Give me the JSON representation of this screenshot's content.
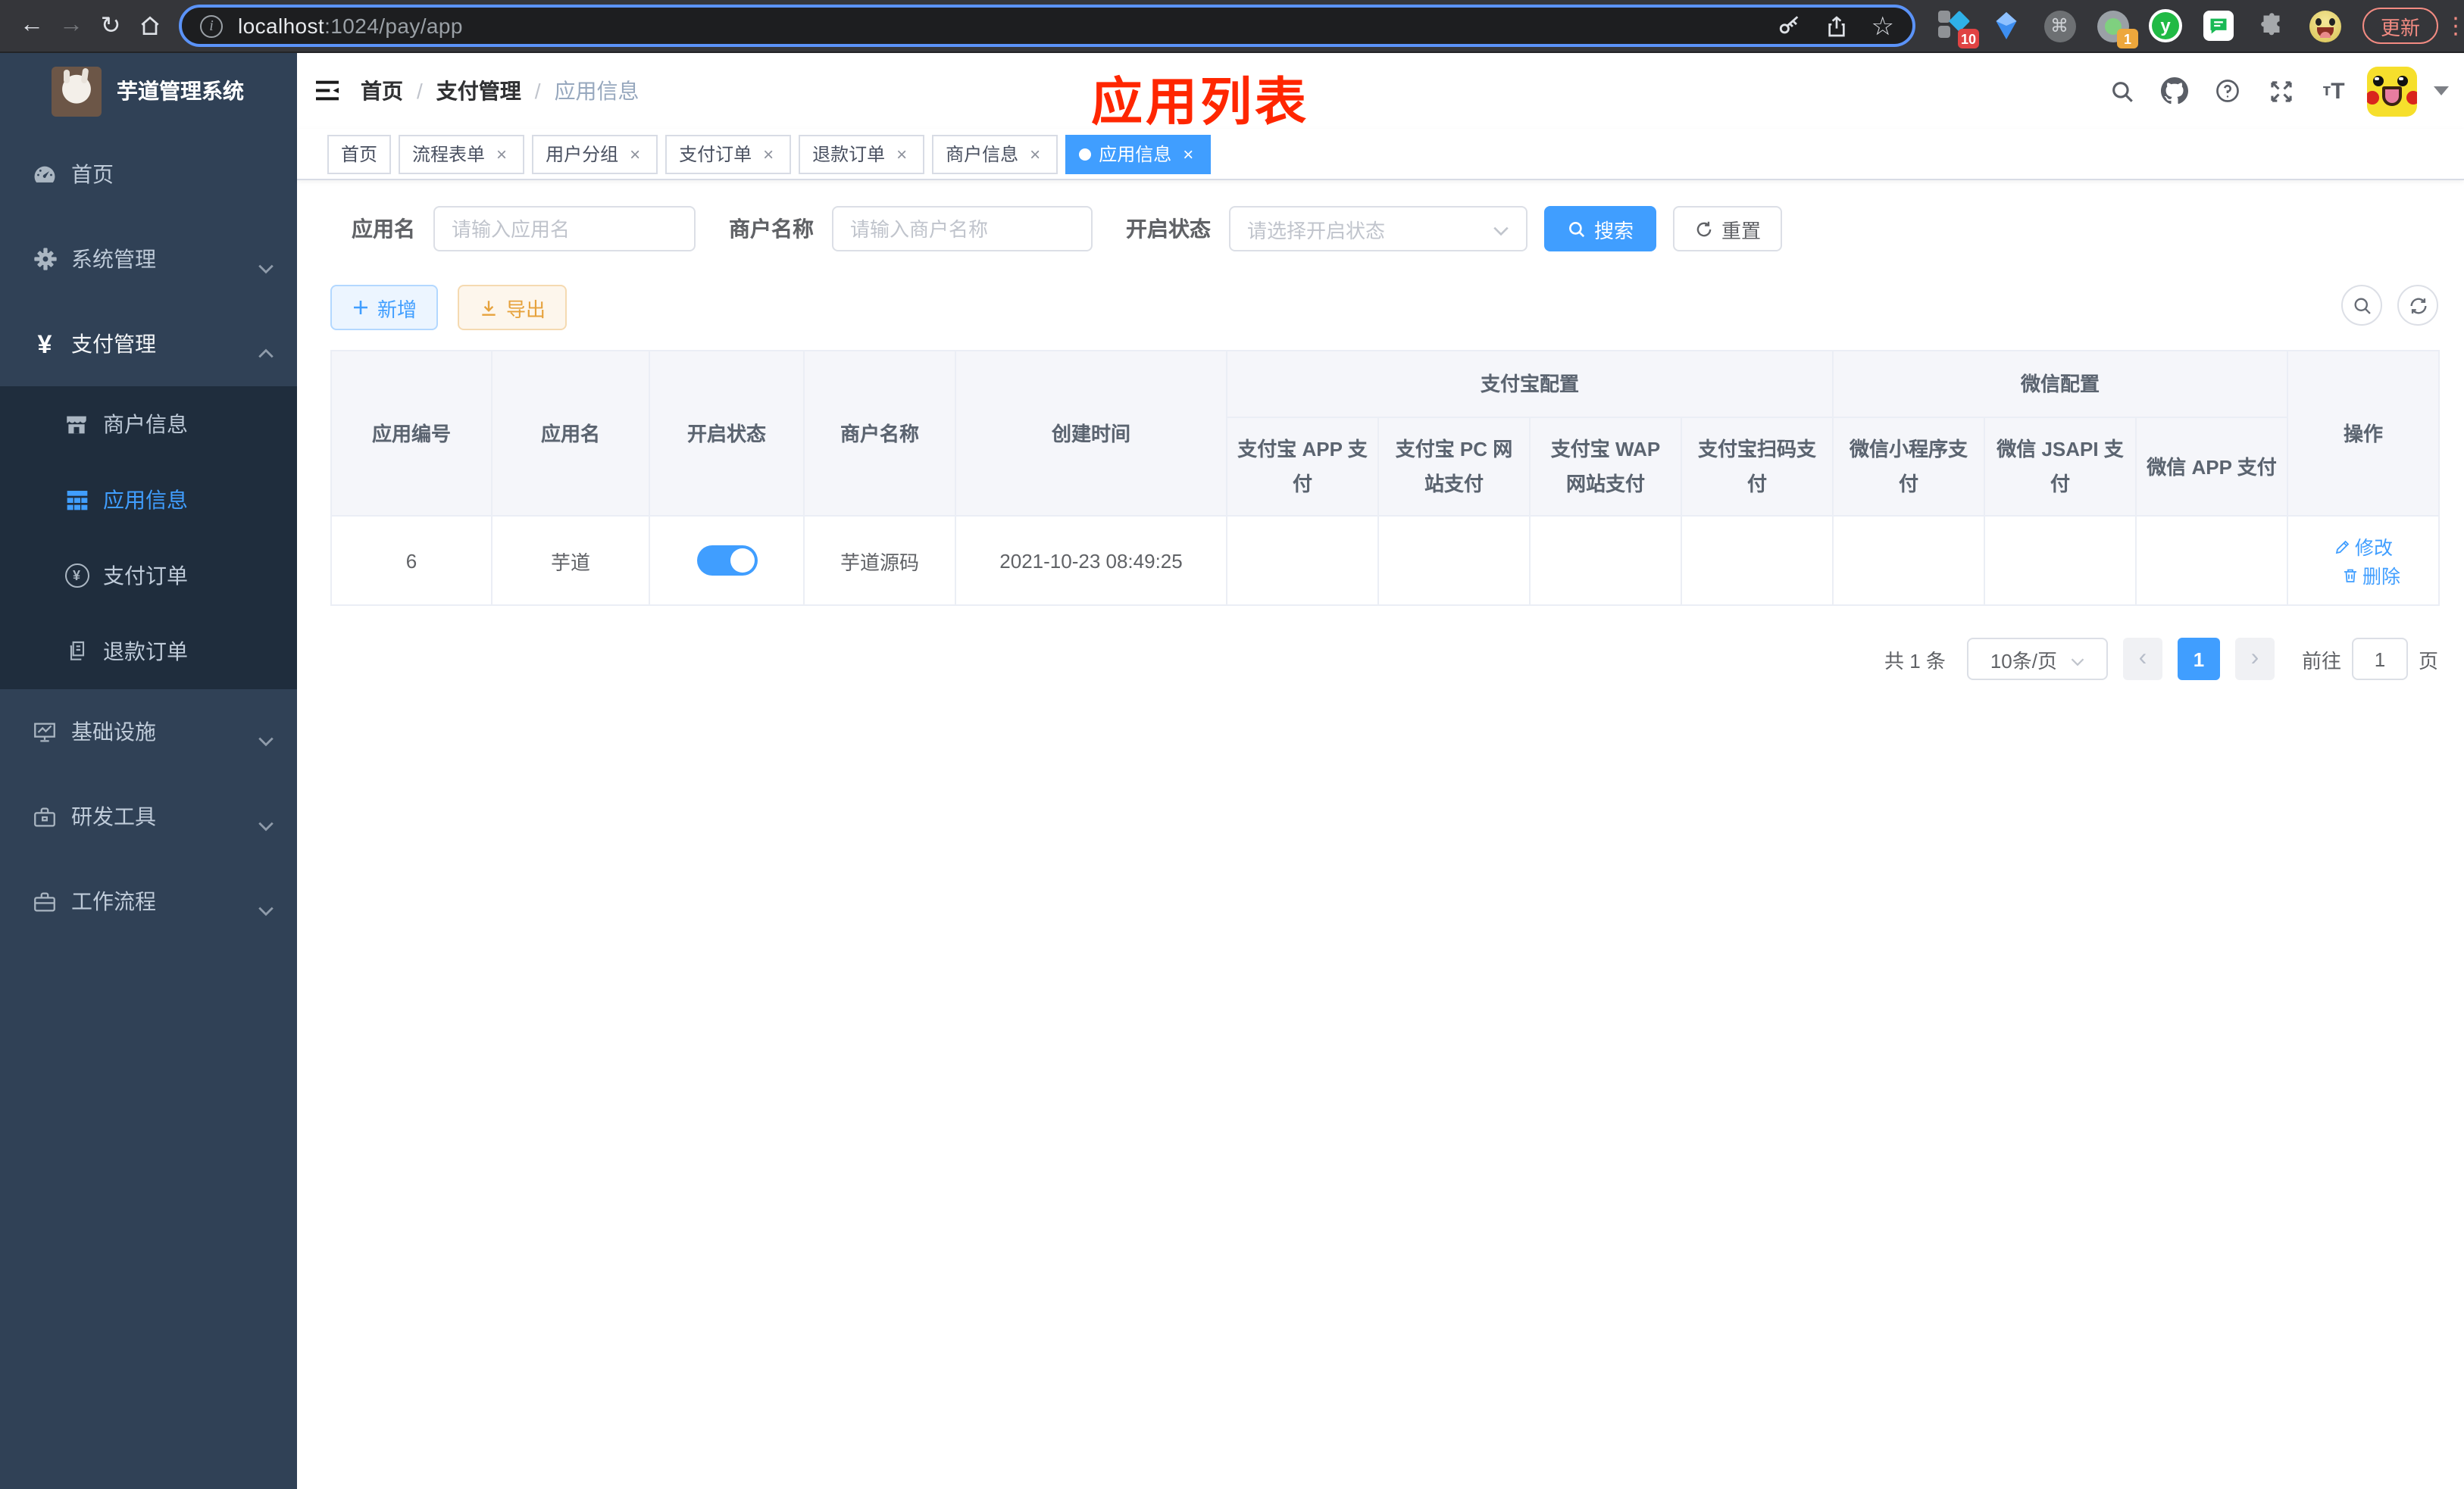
{
  "icons": {
    "back": "←",
    "forward": "→",
    "reload": "↻",
    "star": "☆",
    "command": "⌘",
    "menu_dots": "⋮",
    "close": "×",
    "prev": "‹",
    "next": "›",
    "yen": "¥",
    "ext_y": "y",
    "font_size_small": "т",
    "font_size_big": "T",
    "info": "i"
  },
  "browser": {
    "url_host": "localhost",
    "url_path": ":1024/pay/app",
    "update_label": "更新",
    "ext_badge_blue": "10",
    "ext_badge_record": "1"
  },
  "sidebar": {
    "title": "芋道管理系统",
    "menu": [
      {
        "label": "首页"
      },
      {
        "label": "系统管理"
      },
      {
        "label": "支付管理"
      },
      {
        "label": "商户信息"
      },
      {
        "label": "应用信息"
      },
      {
        "label": "支付订单"
      },
      {
        "label": "退款订单"
      },
      {
        "label": "基础设施"
      },
      {
        "label": "研发工具"
      },
      {
        "label": "工作流程"
      }
    ]
  },
  "navbar": {
    "breadcrumb": {
      "home": "首页",
      "section": "支付管理",
      "current": "应用信息"
    },
    "annotation": "应用列表"
  },
  "tabs": [
    {
      "label": "首页",
      "closable": false,
      "active": false
    },
    {
      "label": "流程表单",
      "closable": true,
      "active": false
    },
    {
      "label": "用户分组",
      "closable": true,
      "active": false
    },
    {
      "label": "支付订单",
      "closable": true,
      "active": false
    },
    {
      "label": "退款订单",
      "closable": true,
      "active": false
    },
    {
      "label": "商户信息",
      "closable": true,
      "active": false
    },
    {
      "label": "应用信息",
      "closable": true,
      "active": true
    }
  ],
  "filters": {
    "app_name_label": "应用名",
    "app_name_placeholder": "请输入应用名",
    "merchant_label": "商户名称",
    "merchant_placeholder": "请输入商户名称",
    "status_label": "开启状态",
    "status_placeholder": "请选择开启状态",
    "search_label": "搜索",
    "reset_label": "重置"
  },
  "toolbar": {
    "add_label": "新增",
    "export_label": "导出"
  },
  "table": {
    "group_alipay": "支付宝配置",
    "group_wechat": "微信配置",
    "col_id": "应用编号",
    "col_name": "应用名",
    "col_status": "开启状态",
    "col_merchant": "商户名称",
    "col_created": "创建时间",
    "col_alipay_app": "支付宝 APP 支付",
    "col_alipay_pc": "支付宝 PC 网站支付",
    "col_alipay_wap": "支付宝 WAP 网站支付",
    "col_alipay_qr": "支付宝扫码支付",
    "col_wx_lite": "微信小程序支付",
    "col_wx_jsapi": "微信 JSAPI 支付",
    "col_wx_app": "微信 APP 支付",
    "col_actions": "操作",
    "row": {
      "id": "6",
      "name": "芋道",
      "enabled": true,
      "merchant": "芋道源码",
      "created": "2021-10-23 08:49:25",
      "alipay_app": false,
      "alipay_pc": false,
      "alipay_wap": false,
      "alipay_qr": false,
      "wx_lite": false,
      "wx_jsapi": true,
      "wx_app": false,
      "edit_label": "修改",
      "delete_label": "删除"
    }
  },
  "pagination": {
    "total": "共 1 条",
    "page_size": "10条/页",
    "current_page": "1",
    "goto_label": "前往",
    "goto_value": "1",
    "page_label": "页"
  },
  "colors": {
    "accent": "#409eff",
    "danger": "#f56c6c",
    "success": "#13ce66",
    "annotation": "#ff2600"
  }
}
